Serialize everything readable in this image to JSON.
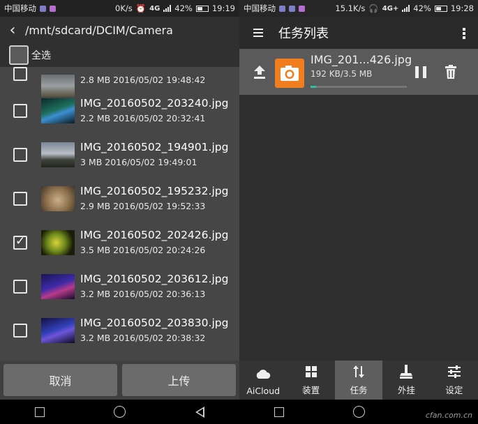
{
  "left": {
    "status": {
      "carrier": "中国移动",
      "speed": "0K/s",
      "network": "4G",
      "battery": "42%",
      "time": "19:19"
    },
    "path": "/mnt/sdcard/DCIM/Camera",
    "select_all_label": "全选",
    "files": [
      {
        "name": "",
        "meta": "2.8 MB 2016/05/02 19:48:42",
        "checked": false
      },
      {
        "name": "IMG_20160502_203240.jpg",
        "meta": "2.2 MB 2016/05/02 20:32:41",
        "checked": false
      },
      {
        "name": "IMG_20160502_194901.jpg",
        "meta": "3 MB 2016/05/02 19:49:01",
        "checked": false
      },
      {
        "name": "IMG_20160502_195232.jpg",
        "meta": "2.9 MB 2016/05/02 19:52:33",
        "checked": false
      },
      {
        "name": "IMG_20160502_202426.jpg",
        "meta": "3.5 MB 2016/05/02 20:24:26",
        "checked": true
      },
      {
        "name": "IMG_20160502_203612.jpg",
        "meta": "3.2 MB 2016/05/02 20:36:13",
        "checked": false
      },
      {
        "name": "IMG_20160502_203830.jpg",
        "meta": "3.2 MB 2016/05/02 20:38:32",
        "checked": false
      }
    ],
    "cancel_label": "取消",
    "upload_label": "上传"
  },
  "right": {
    "status": {
      "carrier": "中国移动",
      "speed": "15.1K/s",
      "network": "4G+",
      "battery": "42%",
      "time": "19:28"
    },
    "title": "任务列表",
    "task": {
      "name": "IMG_201...426.jpg",
      "size": "192 KB/3.5 MB",
      "progress": 0.055,
      "progress_color": "#2ec2a0",
      "icon_color": "#f07d1e"
    },
    "tabs": [
      {
        "label": "AiCloud",
        "icon": "cloud-icon",
        "active": false
      },
      {
        "label": "装置",
        "icon": "grid-icon",
        "active": false
      },
      {
        "label": "任务",
        "icon": "transfer-icon",
        "active": true
      },
      {
        "label": "外挂",
        "icon": "plugin-icon",
        "active": false
      },
      {
        "label": "设定",
        "icon": "sliders-icon",
        "active": false
      }
    ],
    "watermark": "cfan.com.cn"
  }
}
